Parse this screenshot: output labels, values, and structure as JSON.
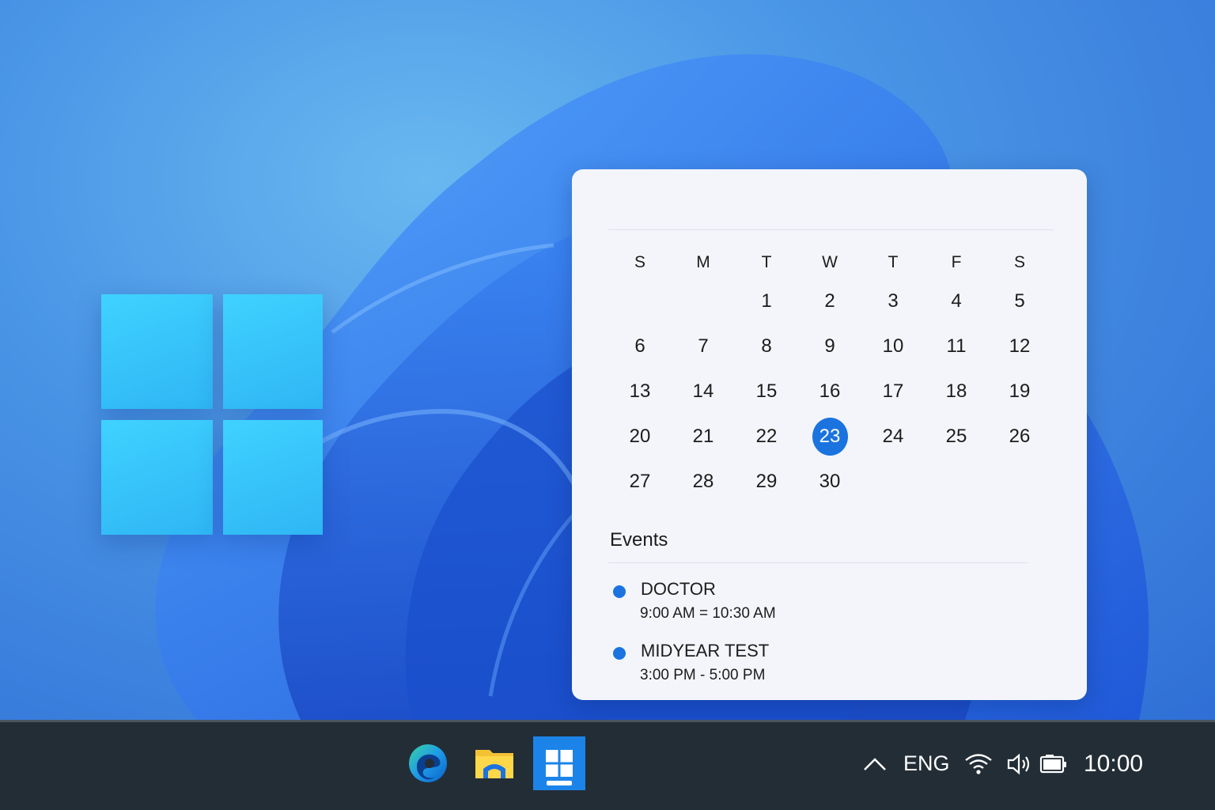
{
  "calendar": {
    "weekdays": [
      "S",
      "M",
      "T",
      "W",
      "T",
      "F",
      "S"
    ],
    "leading_blank_days": 2,
    "days": [
      "1",
      "2",
      "3",
      "4",
      "5",
      "6",
      "7",
      "8",
      "9",
      "10",
      "11",
      "12",
      "13",
      "14",
      "15",
      "16",
      "17",
      "18",
      "19",
      "20",
      "21",
      "22",
      "23",
      "24",
      "25",
      "26",
      "27",
      "28",
      "29",
      "30"
    ],
    "today": "23",
    "accent_color": "#1b73e0"
  },
  "events": {
    "heading": "Events",
    "items": [
      {
        "title": "DOCTOR",
        "time": "9:00 AM = 10:30 AM"
      },
      {
        "title": "MIDYEAR TEST",
        "time": "3:00 PM - 5:00 PM"
      }
    ]
  },
  "taskbar": {
    "apps": [
      "edge-icon",
      "file-explorer-icon",
      "start-icon"
    ],
    "tray": {
      "overflow_icon": "chevron-up-icon",
      "language": "ENG",
      "wifi_icon": "wifi-icon",
      "volume_icon": "volume-icon",
      "battery_icon": "battery-icon",
      "clock": "10:00"
    },
    "background_color": "#232d36"
  }
}
